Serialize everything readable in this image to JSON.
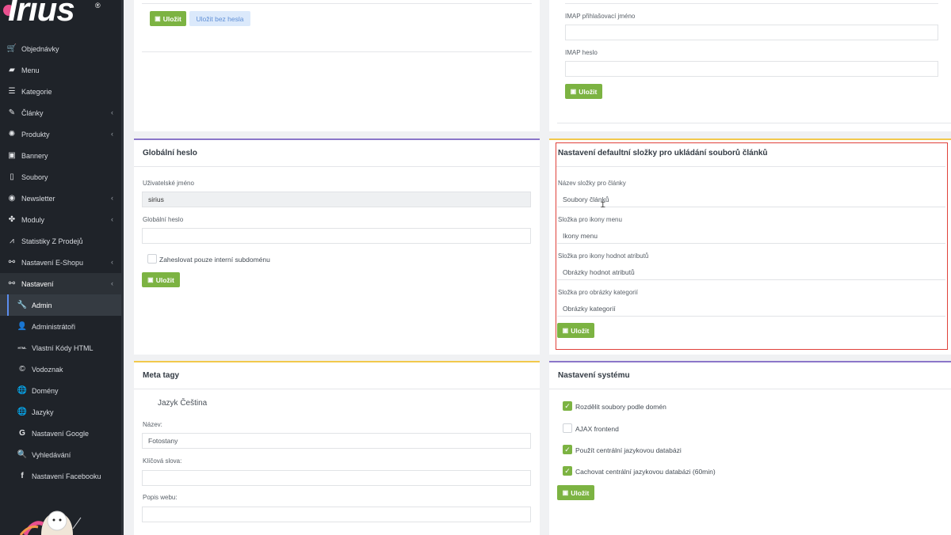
{
  "brand": {
    "name": "Irius",
    "reg": "®"
  },
  "sidebar": {
    "items": [
      {
        "label": "Objednávky",
        "icon": "cart-icon",
        "glyph": "🛒"
      },
      {
        "label": "Menu",
        "icon": "folder-icon",
        "glyph": "▰"
      },
      {
        "label": "Kategorie",
        "icon": "list-icon",
        "glyph": "☰"
      },
      {
        "label": "Články",
        "icon": "pencil-icon",
        "glyph": "✎",
        "chevron": "‹"
      },
      {
        "label": "Produkty",
        "icon": "palette-icon",
        "glyph": "✺",
        "chevron": "‹"
      },
      {
        "label": "Bannery",
        "icon": "image-icon",
        "glyph": "▣"
      },
      {
        "label": "Soubory",
        "icon": "file-icon",
        "glyph": "▯"
      },
      {
        "label": "Newsletter",
        "icon": "newsletter-icon",
        "glyph": "◉",
        "chevron": "‹"
      },
      {
        "label": "Moduly",
        "icon": "puzzle-icon",
        "glyph": "✤",
        "chevron": "‹"
      },
      {
        "label": "Statistiky Z Prodejů",
        "icon": "chart-line-icon",
        "glyph": "⩘"
      },
      {
        "label": "Nastavení E-Shopu",
        "icon": "settings-sliders-icon",
        "glyph": "⚯",
        "chevron": "‹"
      },
      {
        "label": "Nastavení",
        "icon": "settings-sliders-icon",
        "glyph": "⚯",
        "chevron": "‹"
      }
    ],
    "subitems": [
      {
        "label": "Admin",
        "icon": "wrench-icon",
        "glyph": "🔧"
      },
      {
        "label": "Administrátoři",
        "icon": "user-icon",
        "glyph": "👤"
      },
      {
        "label": "Vlastní Kódy HTML",
        "icon": "html-icon",
        "glyph": "HTML"
      },
      {
        "label": "Vodoznak",
        "icon": "copyright-icon",
        "glyph": "©"
      },
      {
        "label": "Domény",
        "icon": "globe-icon",
        "glyph": "🌐"
      },
      {
        "label": "Jazyky",
        "icon": "globe-icon",
        "glyph": "🌐"
      },
      {
        "label": "Nastavení Google",
        "icon": "google-icon",
        "glyph": "G"
      },
      {
        "label": "Vyhledávání",
        "icon": "search-icon",
        "glyph": "🔍"
      },
      {
        "label": "Nastavení Facebooku",
        "icon": "facebook-icon",
        "glyph": "f"
      }
    ]
  },
  "top_left": {
    "save": "Uložit",
    "save_without_password": "Uložit bez hesla"
  },
  "top_right": {
    "imap_login_label": "IMAP přihlašovací jméno",
    "imap_password_label": "IMAP heslo",
    "save": "Uložit"
  },
  "global_password": {
    "title": "Globální heslo",
    "username_label": "Uživatelské jméno",
    "username_value": "sirius",
    "password_label": "Globální heslo",
    "internal_only_label": "Zaheslovat pouze interní subdoménu",
    "save": "Uložit"
  },
  "default_folder": {
    "title": "Nastavení defaultní složky pro ukládání souborů článků",
    "articles_label": "Název složky pro články",
    "articles_value": "Soubory článků",
    "menu_icons_label": "Složka pro ikony menu",
    "menu_icons_value": "Ikony menu",
    "attr_icons_label": "Složka pro ikony hodnot atributů",
    "attr_icons_value": "Obrázky hodnot atributů",
    "category_images_label": "Složka pro obrázky kategorií",
    "category_images_value": "Obrázky kategorií",
    "save": "Uložit"
  },
  "meta_tags": {
    "title": "Meta tagy",
    "language": "Jazyk Čeština",
    "name_label": "Název:",
    "name_value": "Fotostany",
    "keywords_label": "Klíčová slova:",
    "description_label": "Popis webu:"
  },
  "system_settings": {
    "title": "Nastavení systému",
    "options": [
      {
        "label": "Rozdělit soubory podle domén",
        "checked": true
      },
      {
        "label": "AJAX frontend",
        "checked": false
      },
      {
        "label": "Použít centrální jazykovou databázi",
        "checked": true
      },
      {
        "label": "Cachovat centrální jazykovou databázi (60min)",
        "checked": true
      }
    ],
    "save": "Uložit"
  },
  "colors": {
    "sidebar_bg": "#1f2329",
    "accent_green": "#7cb342",
    "accent_purple": "#8b76c9",
    "accent_yellow": "#f2c94c",
    "highlight_red": "#e0413a"
  }
}
